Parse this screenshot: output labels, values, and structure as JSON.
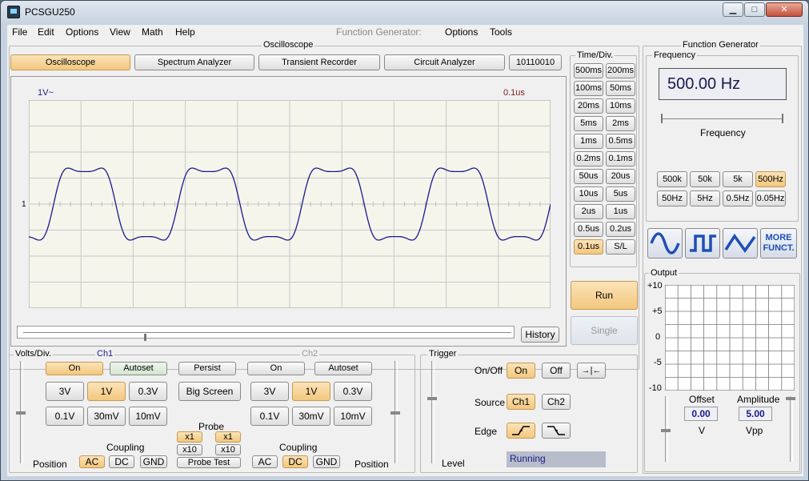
{
  "app": {
    "title": "PCSGU250",
    "min": "▁",
    "max": "□",
    "close": "✕"
  },
  "menu": {
    "file": "File",
    "edit": "Edit",
    "options": "Options",
    "view": "View",
    "math": "Math",
    "help": "Help",
    "fg_label": "Function Generator:",
    "fg_options": "Options",
    "fg_tools": "Tools"
  },
  "osc": {
    "group_title": "Oscilloscope",
    "tabs": [
      "Oscilloscope",
      "Spectrum Analyzer",
      "Transient Recorder",
      "Circuit Analyzer",
      "10110010"
    ],
    "scale_label": "1V~",
    "time_label": "0.1us",
    "ch_marker": "1",
    "history": "History"
  },
  "waveform": {
    "type": "line",
    "trace_color": "#1a1a8c",
    "grid_background": "#f5f5ec"
  },
  "timediv": {
    "title": "Time/Div.",
    "buttons": [
      "500ms",
      "200ms",
      "100ms",
      "50ms",
      "20ms",
      "10ms",
      "5ms",
      "2ms",
      "1ms",
      "0.5ms",
      "0.2ms",
      "0.1ms",
      "50us",
      "20us",
      "10us",
      "5us",
      "2us",
      "1us",
      "0.5us",
      "0.2us",
      "0.1us",
      "S/L"
    ],
    "selected": "0.1us"
  },
  "run": {
    "run": "Run",
    "single": "Single"
  },
  "volts": {
    "title": "Volts/Div.",
    "ch1": "Ch1",
    "ch2": "Ch2",
    "on": "On",
    "autoset": "Autoset",
    "persist": "Persist",
    "big_screen": "Big Screen",
    "ranges": [
      "3V",
      "1V",
      "0.3V",
      "0.1V",
      "30mV",
      "10mV"
    ],
    "probe": "Probe",
    "x1": "x1",
    "x10": "x10",
    "probe_test": "Probe Test",
    "coupling": "Coupling",
    "ac": "AC",
    "dc": "DC",
    "gnd": "GND",
    "position": "Position"
  },
  "trigger": {
    "title": "Trigger",
    "onoff": "On/Off",
    "on": "On",
    "off": "Off",
    "source": "Source",
    "ch1": "Ch1",
    "ch2": "Ch2",
    "edge": "Edge",
    "level": "Level",
    "status": "Running"
  },
  "fg": {
    "title": "Function Generator",
    "freq_title": "Frequency",
    "freq_value": "500.00 Hz",
    "freq_slider_label": "Frequency",
    "ranges": [
      "500k",
      "50k",
      "5k",
      "500Hz",
      "50Hz",
      "5Hz",
      "0.5Hz",
      "0.05Hz"
    ],
    "selected_range": "500Hz",
    "more": "MORE\nFUNCT.",
    "output_title": "Output",
    "y_ticks": [
      "+10",
      "+5",
      "0",
      "-5",
      "-10"
    ],
    "offset_label": "Offset",
    "offset_value": "0.00",
    "offset_unit": "V",
    "amp_label": "Amplitude",
    "amp_value": "5.00",
    "amp_unit": "Vpp"
  }
}
